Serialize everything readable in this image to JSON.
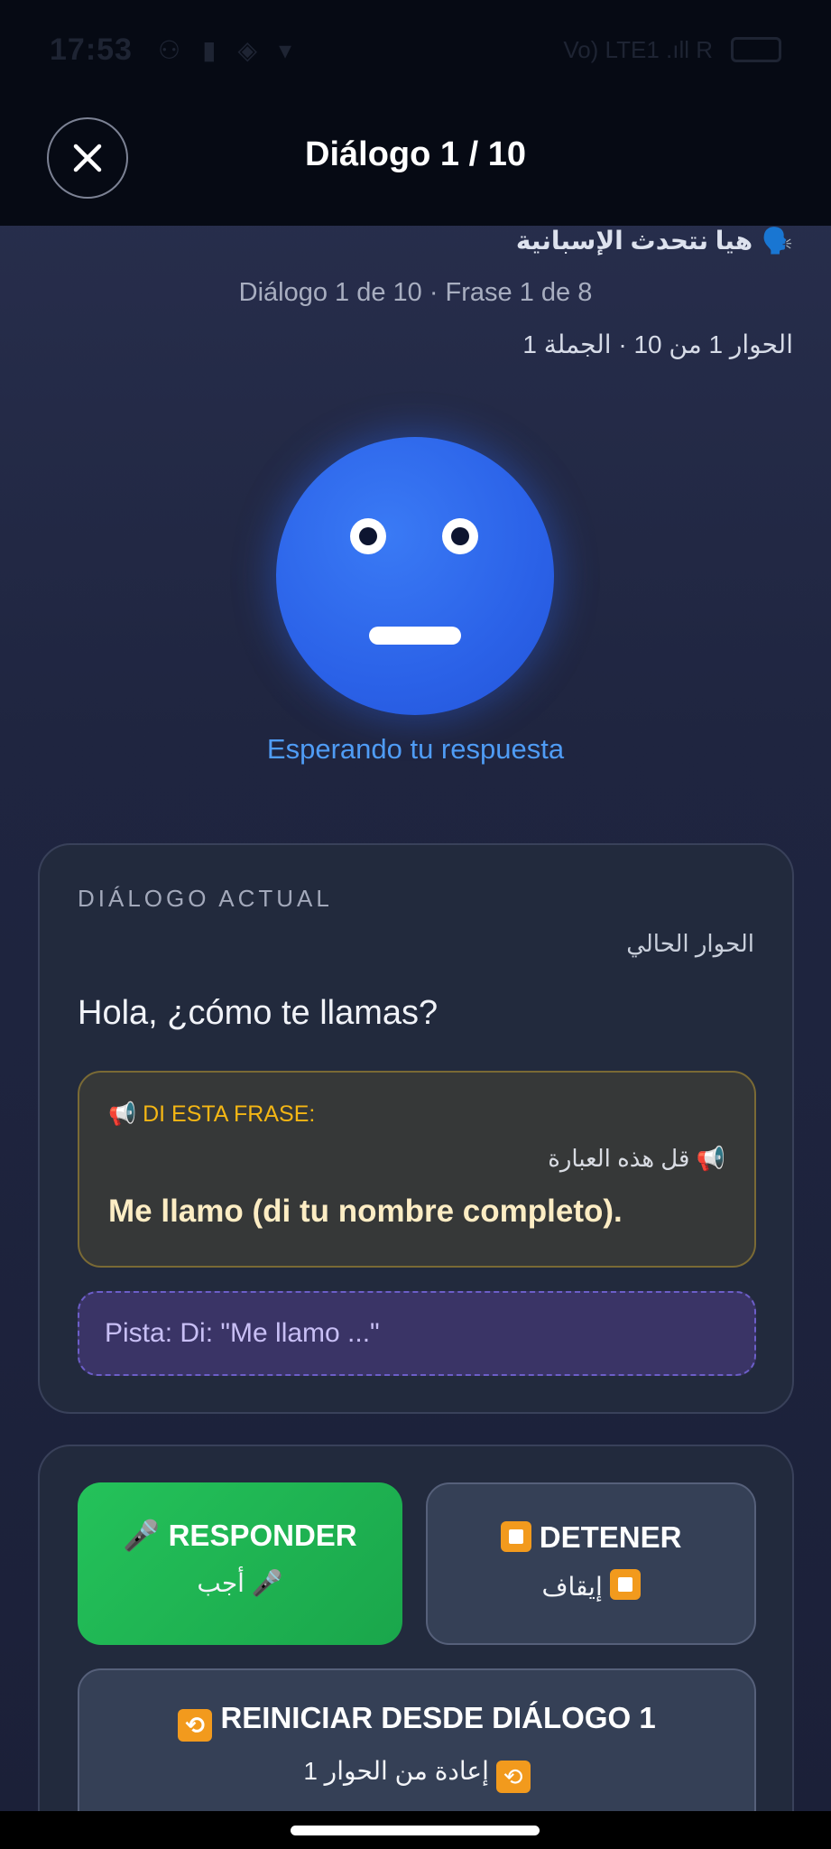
{
  "status_bar": {
    "time": "17:53",
    "icons": [
      "person-icon",
      "sim-icon",
      "notification-icon",
      "chevron-icon"
    ],
    "right_text": "Vo) LTE1 .ıll R"
  },
  "header": {
    "title": "Diálogo 1 / 10",
    "close_icon": "close-icon"
  },
  "lesson": {
    "title_ar": "هيا نتحدث الإسبانية",
    "title_emoji": "🗣️",
    "progress_es": "Diálogo 1 de 10 · Frase 1 de 8",
    "progress_ar": "الحوار 1 من 10 · الجملة 1"
  },
  "avatar": {
    "status": "Esperando tu respuesta",
    "color": "#2b62e8"
  },
  "dialog_card": {
    "label_es": "DIÁLOGO ACTUAL",
    "label_ar": "الحوار الحالي",
    "question": "Hola, ¿cómo te llamas?",
    "say_label_es": "📢 DI ESTA FRASE:",
    "say_label_ar": "📢 قل هذه العبارة",
    "say_phrase": "Me llamo (di tu nombre completo).",
    "hint": "Pista: Di: \"Me llamo ...\""
  },
  "actions": {
    "respond_label": "🎤 RESPONDER",
    "respond_label_ar": "🎤 أجب",
    "stop_label": "DETENER",
    "stop_label_ar": "إيقاف",
    "restart_label": "REINICIAR DESDE DIÁLOGO 1",
    "restart_label_ar": "إعادة من الحوار 1"
  },
  "colors": {
    "accent_green": "#22c05a",
    "accent_blue": "#4f9cf5",
    "accent_yellow": "#f4b614",
    "hint_purple": "#6c5ec8"
  }
}
